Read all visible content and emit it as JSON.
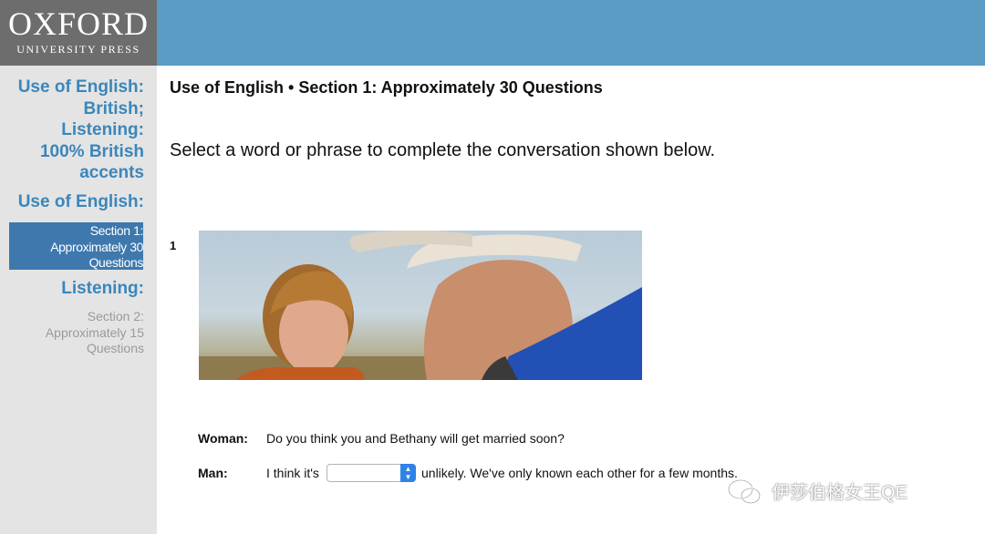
{
  "header": {
    "logo_main": "OXFORD",
    "logo_sub": "UNIVERSITY PRESS"
  },
  "sidebar": {
    "group1": [
      "Use of English:",
      "British;",
      "Listening:",
      "100% British",
      "accents"
    ],
    "group2": "Use of English:",
    "active_item": [
      "Section 1:",
      "Approximately 30",
      "Questions"
    ],
    "group3": "Listening:",
    "link_item": [
      "Section 2:",
      "Approximately 15",
      "Questions"
    ]
  },
  "main": {
    "title": "Use of English • Section 1: Approximately 30 Questions",
    "instruction": "Select a word or phrase to complete the conversation shown below.",
    "question_number": "1",
    "dialogue": [
      {
        "speaker": "Woman:",
        "text": "Do you think you and Bethany will get married soon?"
      },
      {
        "speaker": "Man:",
        "text_before": "I think it's",
        "text_after": "unlikely. We've only known each other for a few months."
      }
    ],
    "select_value": "",
    "select_arrow_icon": "chevron-updown-icon"
  },
  "watermark": {
    "text": "伊莎伯格女王QE",
    "icon": "wechat-icon"
  },
  "colors": {
    "header_blue": "#5b9cc4",
    "logo_gray": "#6d6d6d",
    "sidebar_bg": "#e4e4e4",
    "sidebar_heading": "#3b86bb",
    "active_bg": "#3e78ad",
    "select_accent": "#2f82e8"
  }
}
